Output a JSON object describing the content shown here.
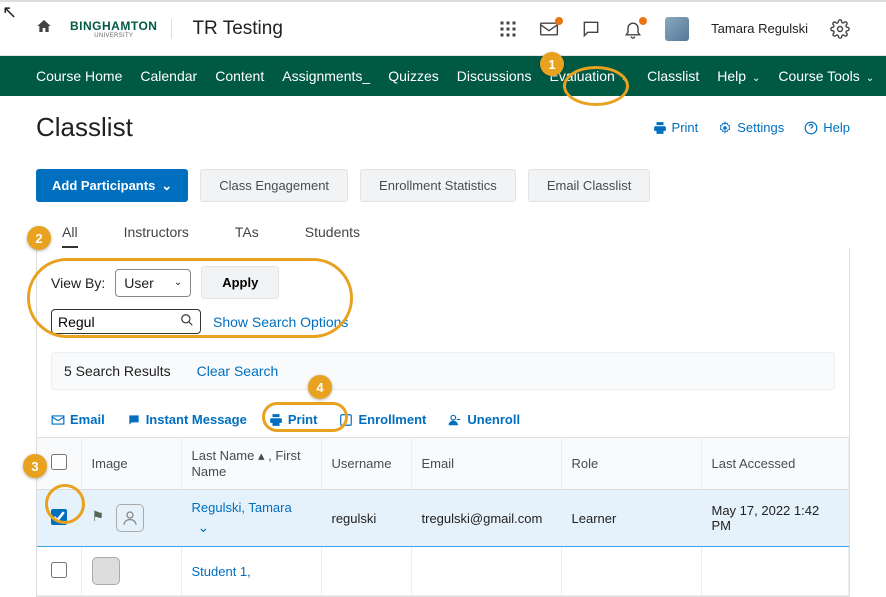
{
  "topbar": {
    "logo_top": "BINGHAMTON",
    "logo_sub": "UNIVERSITY",
    "course_title": "TR Testing",
    "username": "Tamara Regulski"
  },
  "nav": {
    "items": [
      "Course Home",
      "Calendar",
      "Content",
      "Assignments_",
      "Quizzes",
      "Discussions",
      "Evaluation",
      "Classlist",
      "Help",
      "Course Tools"
    ],
    "has_caret": [
      false,
      false,
      false,
      false,
      false,
      false,
      true,
      false,
      true,
      true
    ]
  },
  "page": {
    "title": "Classlist",
    "print": "Print",
    "settings": "Settings",
    "help": "Help"
  },
  "buttons": {
    "add_participants": "Add Participants",
    "class_engagement": "Class Engagement",
    "enrollment_stats": "Enrollment Statistics",
    "email_classlist": "Email Classlist"
  },
  "tabs": [
    "All",
    "Instructors",
    "TAs",
    "Students"
  ],
  "filter": {
    "view_by_label": "View By:",
    "view_by_value": "User",
    "apply": "Apply",
    "search_value": "Regul",
    "show_search_options": "Show Search Options",
    "results_text": "5 Search Results",
    "clear_search": "Clear Search"
  },
  "bulk": {
    "email": "Email",
    "instant_message": "Instant Message",
    "print": "Print",
    "enrollment": "Enrollment",
    "unenroll": "Unenroll"
  },
  "table": {
    "headers": {
      "image": "Image",
      "name": "Last Name ▴ , First Name",
      "username": "Username",
      "email": "Email",
      "role": "Role",
      "last_accessed": "Last Accessed"
    },
    "rows": [
      {
        "checked": true,
        "name": "Regulski, Tamara",
        "username": "regulski",
        "email": "tregulski@gmail.com",
        "role": "Learner",
        "last_accessed": "May 17, 2022 1:42 PM"
      },
      {
        "checked": false,
        "name": "Student 1,",
        "username": "",
        "email": "",
        "role": "",
        "last_accessed": ""
      }
    ]
  },
  "annotations": {
    "1": "1",
    "2": "2",
    "3": "3",
    "4": "4"
  }
}
